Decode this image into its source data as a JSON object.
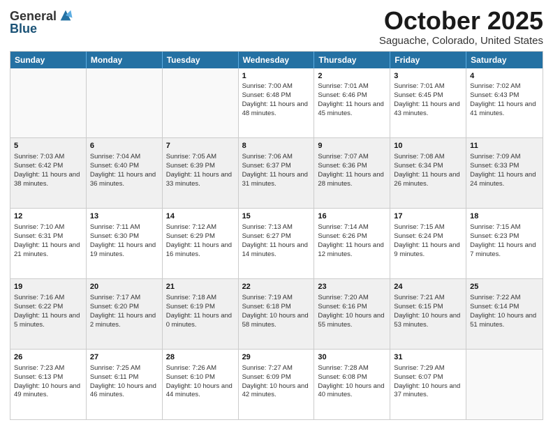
{
  "logo": {
    "general": "General",
    "blue": "Blue"
  },
  "title": "October 2025",
  "location": "Saguache, Colorado, United States",
  "header_days": [
    "Sunday",
    "Monday",
    "Tuesday",
    "Wednesday",
    "Thursday",
    "Friday",
    "Saturday"
  ],
  "rows": [
    [
      {
        "day": "",
        "sunrise": "",
        "sunset": "",
        "daylight": "",
        "empty": true
      },
      {
        "day": "",
        "sunrise": "",
        "sunset": "",
        "daylight": "",
        "empty": true
      },
      {
        "day": "",
        "sunrise": "",
        "sunset": "",
        "daylight": "",
        "empty": true
      },
      {
        "day": "1",
        "sunrise": "Sunrise: 7:00 AM",
        "sunset": "Sunset: 6:48 PM",
        "daylight": "Daylight: 11 hours and 48 minutes."
      },
      {
        "day": "2",
        "sunrise": "Sunrise: 7:01 AM",
        "sunset": "Sunset: 6:46 PM",
        "daylight": "Daylight: 11 hours and 45 minutes."
      },
      {
        "day": "3",
        "sunrise": "Sunrise: 7:01 AM",
        "sunset": "Sunset: 6:45 PM",
        "daylight": "Daylight: 11 hours and 43 minutes."
      },
      {
        "day": "4",
        "sunrise": "Sunrise: 7:02 AM",
        "sunset": "Sunset: 6:43 PM",
        "daylight": "Daylight: 11 hours and 41 minutes."
      }
    ],
    [
      {
        "day": "5",
        "sunrise": "Sunrise: 7:03 AM",
        "sunset": "Sunset: 6:42 PM",
        "daylight": "Daylight: 11 hours and 38 minutes."
      },
      {
        "day": "6",
        "sunrise": "Sunrise: 7:04 AM",
        "sunset": "Sunset: 6:40 PM",
        "daylight": "Daylight: 11 hours and 36 minutes."
      },
      {
        "day": "7",
        "sunrise": "Sunrise: 7:05 AM",
        "sunset": "Sunset: 6:39 PM",
        "daylight": "Daylight: 11 hours and 33 minutes."
      },
      {
        "day": "8",
        "sunrise": "Sunrise: 7:06 AM",
        "sunset": "Sunset: 6:37 PM",
        "daylight": "Daylight: 11 hours and 31 minutes."
      },
      {
        "day": "9",
        "sunrise": "Sunrise: 7:07 AM",
        "sunset": "Sunset: 6:36 PM",
        "daylight": "Daylight: 11 hours and 28 minutes."
      },
      {
        "day": "10",
        "sunrise": "Sunrise: 7:08 AM",
        "sunset": "Sunset: 6:34 PM",
        "daylight": "Daylight: 11 hours and 26 minutes."
      },
      {
        "day": "11",
        "sunrise": "Sunrise: 7:09 AM",
        "sunset": "Sunset: 6:33 PM",
        "daylight": "Daylight: 11 hours and 24 minutes."
      }
    ],
    [
      {
        "day": "12",
        "sunrise": "Sunrise: 7:10 AM",
        "sunset": "Sunset: 6:31 PM",
        "daylight": "Daylight: 11 hours and 21 minutes."
      },
      {
        "day": "13",
        "sunrise": "Sunrise: 7:11 AM",
        "sunset": "Sunset: 6:30 PM",
        "daylight": "Daylight: 11 hours and 19 minutes."
      },
      {
        "day": "14",
        "sunrise": "Sunrise: 7:12 AM",
        "sunset": "Sunset: 6:29 PM",
        "daylight": "Daylight: 11 hours and 16 minutes."
      },
      {
        "day": "15",
        "sunrise": "Sunrise: 7:13 AM",
        "sunset": "Sunset: 6:27 PM",
        "daylight": "Daylight: 11 hours and 14 minutes."
      },
      {
        "day": "16",
        "sunrise": "Sunrise: 7:14 AM",
        "sunset": "Sunset: 6:26 PM",
        "daylight": "Daylight: 11 hours and 12 minutes."
      },
      {
        "day": "17",
        "sunrise": "Sunrise: 7:15 AM",
        "sunset": "Sunset: 6:24 PM",
        "daylight": "Daylight: 11 hours and 9 minutes."
      },
      {
        "day": "18",
        "sunrise": "Sunrise: 7:15 AM",
        "sunset": "Sunset: 6:23 PM",
        "daylight": "Daylight: 11 hours and 7 minutes."
      }
    ],
    [
      {
        "day": "19",
        "sunrise": "Sunrise: 7:16 AM",
        "sunset": "Sunset: 6:22 PM",
        "daylight": "Daylight: 11 hours and 5 minutes."
      },
      {
        "day": "20",
        "sunrise": "Sunrise: 7:17 AM",
        "sunset": "Sunset: 6:20 PM",
        "daylight": "Daylight: 11 hours and 2 minutes."
      },
      {
        "day": "21",
        "sunrise": "Sunrise: 7:18 AM",
        "sunset": "Sunset: 6:19 PM",
        "daylight": "Daylight: 11 hours and 0 minutes."
      },
      {
        "day": "22",
        "sunrise": "Sunrise: 7:19 AM",
        "sunset": "Sunset: 6:18 PM",
        "daylight": "Daylight: 10 hours and 58 minutes."
      },
      {
        "day": "23",
        "sunrise": "Sunrise: 7:20 AM",
        "sunset": "Sunset: 6:16 PM",
        "daylight": "Daylight: 10 hours and 55 minutes."
      },
      {
        "day": "24",
        "sunrise": "Sunrise: 7:21 AM",
        "sunset": "Sunset: 6:15 PM",
        "daylight": "Daylight: 10 hours and 53 minutes."
      },
      {
        "day": "25",
        "sunrise": "Sunrise: 7:22 AM",
        "sunset": "Sunset: 6:14 PM",
        "daylight": "Daylight: 10 hours and 51 minutes."
      }
    ],
    [
      {
        "day": "26",
        "sunrise": "Sunrise: 7:23 AM",
        "sunset": "Sunset: 6:13 PM",
        "daylight": "Daylight: 10 hours and 49 minutes."
      },
      {
        "day": "27",
        "sunrise": "Sunrise: 7:25 AM",
        "sunset": "Sunset: 6:11 PM",
        "daylight": "Daylight: 10 hours and 46 minutes."
      },
      {
        "day": "28",
        "sunrise": "Sunrise: 7:26 AM",
        "sunset": "Sunset: 6:10 PM",
        "daylight": "Daylight: 10 hours and 44 minutes."
      },
      {
        "day": "29",
        "sunrise": "Sunrise: 7:27 AM",
        "sunset": "Sunset: 6:09 PM",
        "daylight": "Daylight: 10 hours and 42 minutes."
      },
      {
        "day": "30",
        "sunrise": "Sunrise: 7:28 AM",
        "sunset": "Sunset: 6:08 PM",
        "daylight": "Daylight: 10 hours and 40 minutes."
      },
      {
        "day": "31",
        "sunrise": "Sunrise: 7:29 AM",
        "sunset": "Sunset: 6:07 PM",
        "daylight": "Daylight: 10 hours and 37 minutes."
      },
      {
        "day": "",
        "sunrise": "",
        "sunset": "",
        "daylight": "",
        "empty": true
      }
    ]
  ]
}
